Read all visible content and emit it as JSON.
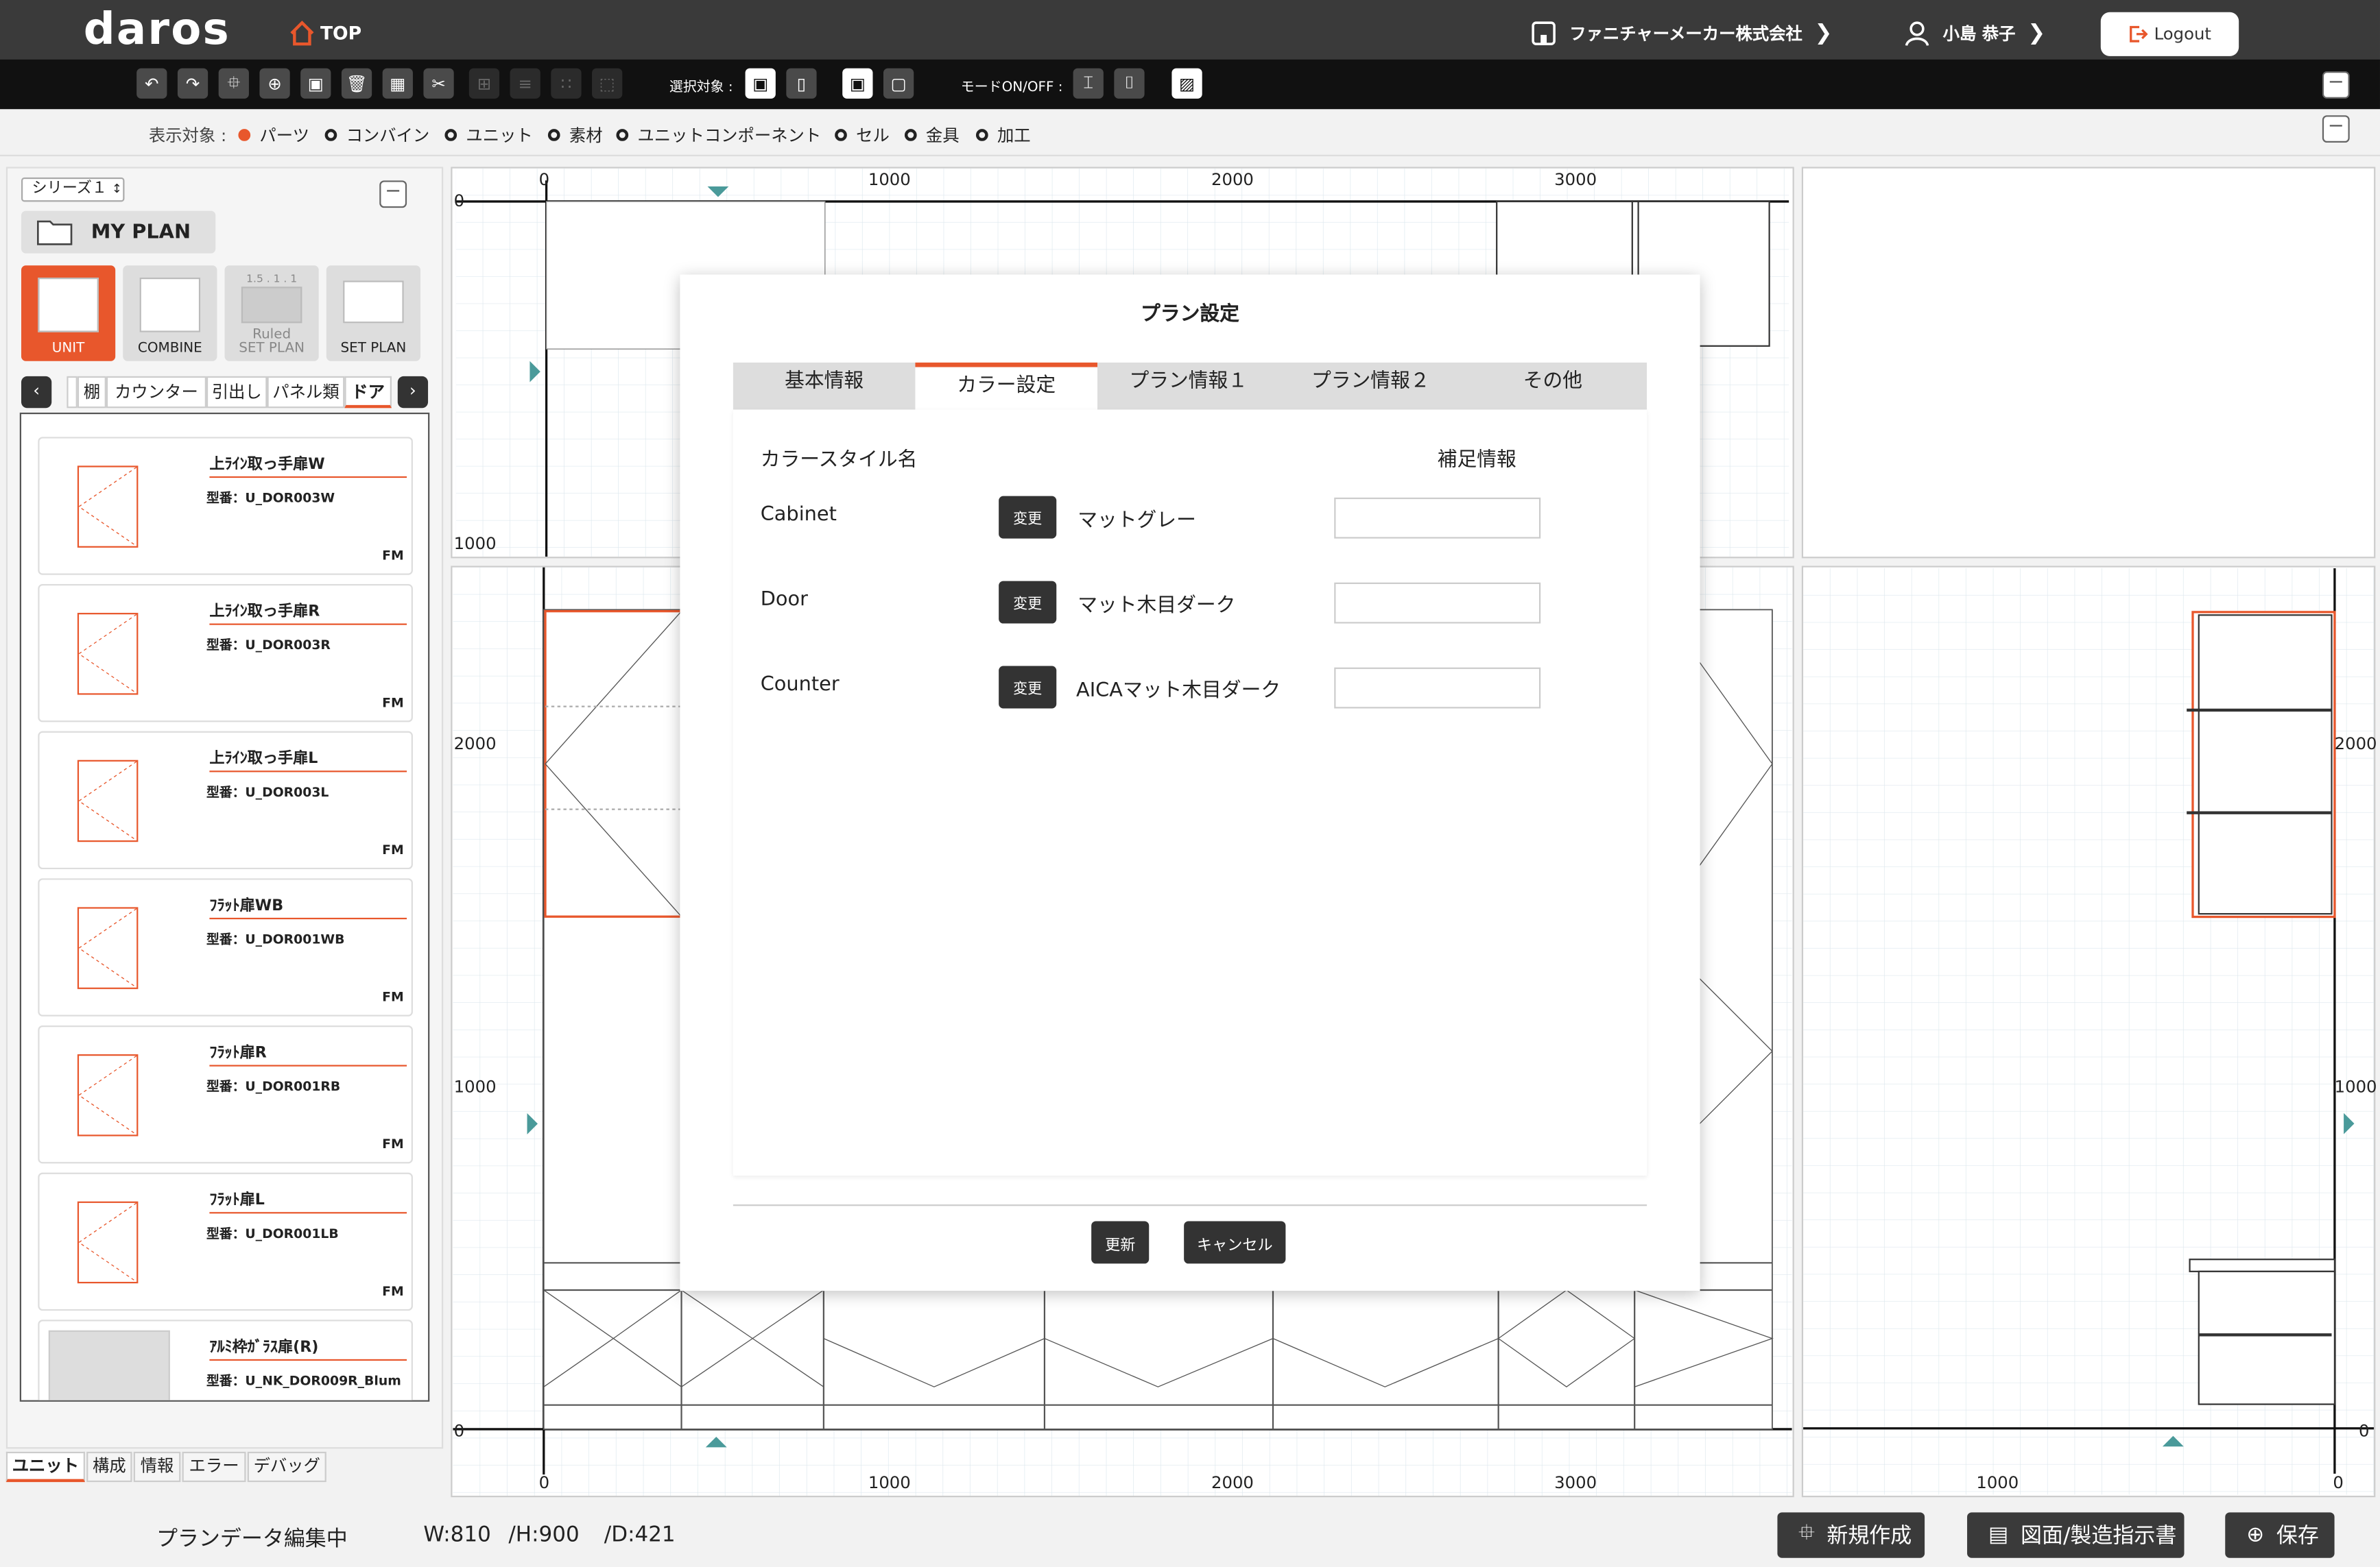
{
  "header": {
    "logo": "daros",
    "top_label": "TOP",
    "company": "ファニチャーメーカー株式会社",
    "user": "小島 恭子",
    "logout": "Logout"
  },
  "toolbar": {
    "select_target_label": "選択対象 :",
    "mode_label": "モードON/OFF :"
  },
  "filter": {
    "label": "表示対象 :",
    "options": [
      "パーツ",
      "コンバイン",
      "ユニット",
      "素材",
      "ユニットコンポーネント",
      "セル",
      "金具",
      "加工"
    ],
    "selected": "パーツ"
  },
  "left": {
    "series": "シリーズ１",
    "myplan": "MY PLAN",
    "categories": [
      "UNIT",
      "COMBINE",
      "Ruled SET PLAN",
      "SET PLAN"
    ],
    "ruled_dims": "1.5 . 1 . 1",
    "ruled_line1": "Ruled",
    "ruled_line2": "SET PLAN",
    "tabs": [
      "棚",
      "カウンター",
      "引出し",
      "パネル類",
      "ドア"
    ],
    "active_tab": "ドア",
    "parts": [
      {
        "name": "上ﾗｲﾝ取っ手扉W",
        "code": "型番：U_DOR003W",
        "tag": "FM"
      },
      {
        "name": "上ﾗｲﾝ取っ手扉R",
        "code": "型番：U_DOR003R",
        "tag": "FM"
      },
      {
        "name": "上ﾗｲﾝ取っ手扉L",
        "code": "型番：U_DOR003L",
        "tag": "FM"
      },
      {
        "name": "ﾌﾗｯﾄ扉WB",
        "code": "型番：U_DOR001WB",
        "tag": "FM"
      },
      {
        "name": "ﾌﾗｯﾄ扉R",
        "code": "型番：U_DOR001RB",
        "tag": "FM"
      },
      {
        "name": "ﾌﾗｯﾄ扉L",
        "code": "型番：U_DOR001LB",
        "tag": "FM"
      },
      {
        "name": "ｱﾙﾐ枠ｶﾞﾗｽ扉(R)",
        "code": "型番：U_NK_DOR009R_Blum",
        "tag": ""
      }
    ],
    "bottom_tabs": [
      "ユニット",
      "構成",
      "情報",
      "エラー",
      "デバッグ"
    ]
  },
  "views": {
    "top_x_labels": [
      "0",
      "1000",
      "2000",
      "3000"
    ],
    "top_y_labels": [
      "0",
      "1000"
    ],
    "front_y_labels": [
      "2000",
      "1000",
      "0"
    ],
    "front_x_labels": [
      "0",
      "1000",
      "2000",
      "3000"
    ],
    "side_y_labels": [
      "2000",
      "1000",
      "0"
    ],
    "side_x_labels": [
      "1000",
      "0"
    ]
  },
  "status": {
    "text": "プランデータ編集中",
    "w": "W:810",
    "h": "/H:900",
    "d": "/D:421",
    "btn_new": "新規作成",
    "btn_drawing": "図面/製造指示書",
    "btn_save": "保存"
  },
  "modal": {
    "title": "プラン設定",
    "tabs": [
      "基本情報",
      "カラー設定",
      "プラン情報１",
      "プラン情報２",
      "その他"
    ],
    "active_tab": "カラー設定",
    "col_style": "カラースタイル名",
    "col_note": "補足情報",
    "rows": [
      {
        "label": "Cabinet",
        "button": "変更",
        "value": "マットグレー",
        "note": ""
      },
      {
        "label": "Door",
        "button": "変更",
        "value": "マット木目ダーク",
        "note": ""
      },
      {
        "label": "Counter",
        "button": "変更",
        "value": "AICAマット木目ダーク",
        "note": ""
      }
    ],
    "update": "更新",
    "cancel": "キャンセル"
  },
  "colors": {
    "accent": "#e8572c",
    "header": "#3a3a3a",
    "toolbar": "#111111"
  }
}
